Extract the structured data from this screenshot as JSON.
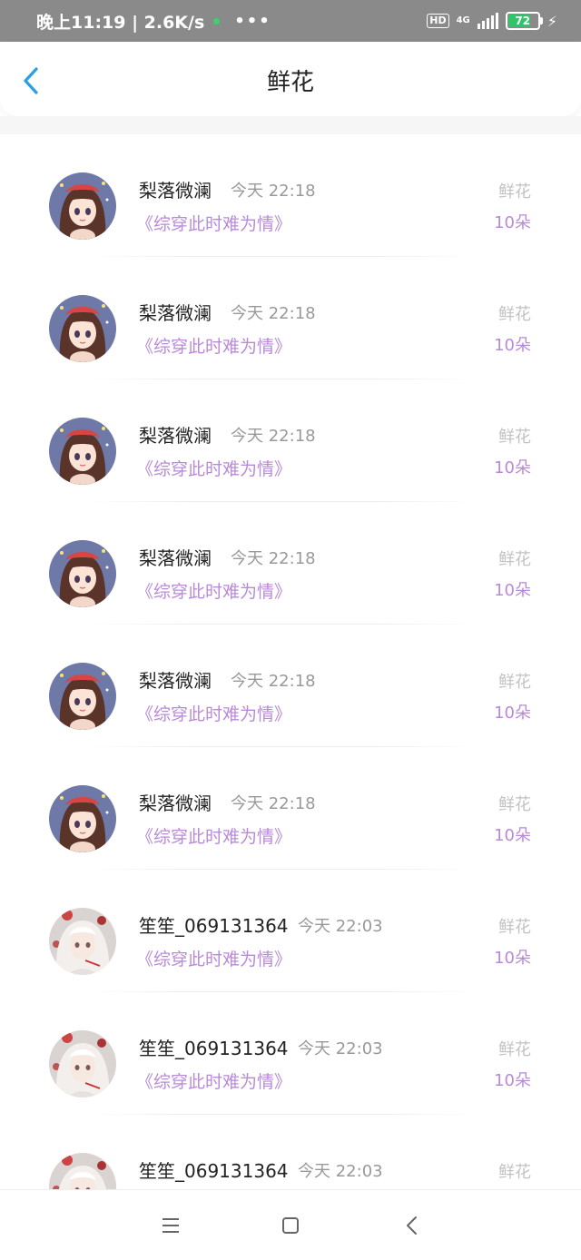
{
  "status_bar": {
    "time_speed": "晚上11:19 | 2.6K/s",
    "more": "•••",
    "hd": "HD",
    "network": "4G",
    "battery": "72"
  },
  "header": {
    "title": "鲜花",
    "back_icon": "chevron-left-icon"
  },
  "colors": {
    "accent": "#2a9ee6",
    "book_purple": "#b98ad8",
    "muted": "#999999"
  },
  "items": [
    {
      "name": "梨落微澜",
      "time": "今天 22:18",
      "book": "《综穿此时难为情》",
      "gift_type": "鲜花",
      "gift_count": "10朵",
      "avatar": "girl-avatar"
    },
    {
      "name": "梨落微澜",
      "time": "今天 22:18",
      "book": "《综穿此时难为情》",
      "gift_type": "鲜花",
      "gift_count": "10朵",
      "avatar": "girl-avatar"
    },
    {
      "name": "梨落微澜",
      "time": "今天 22:18",
      "book": "《综穿此时难为情》",
      "gift_type": "鲜花",
      "gift_count": "10朵",
      "avatar": "girl-avatar"
    },
    {
      "name": "梨落微澜",
      "time": "今天 22:18",
      "book": "《综穿此时难为情》",
      "gift_type": "鲜花",
      "gift_count": "10朵",
      "avatar": "girl-avatar"
    },
    {
      "name": "梨落微澜",
      "time": "今天 22:18",
      "book": "《综穿此时难为情》",
      "gift_type": "鲜花",
      "gift_count": "10朵",
      "avatar": "girl-avatar"
    },
    {
      "name": "梨落微澜",
      "time": "今天 22:18",
      "book": "《综穿此时难为情》",
      "gift_type": "鲜花",
      "gift_count": "10朵",
      "avatar": "girl-avatar"
    },
    {
      "name": "笙笙_069131364",
      "time": "今天 22:03",
      "book": "《综穿此时难为情》",
      "gift_type": "鲜花",
      "gift_count": "10朵",
      "avatar": "white-hair-avatar"
    },
    {
      "name": "笙笙_069131364",
      "time": "今天 22:03",
      "book": "《综穿此时难为情》",
      "gift_type": "鲜花",
      "gift_count": "10朵",
      "avatar": "white-hair-avatar"
    },
    {
      "name": "笙笙_069131364",
      "time": "今天 22:03",
      "book": "",
      "gift_type": "鲜花",
      "gift_count": "",
      "avatar": "white-hair-avatar"
    }
  ],
  "nav": {
    "menu_icon": "menu-icon",
    "home_icon": "home-square-icon",
    "back_icon": "triangle-back-icon"
  }
}
